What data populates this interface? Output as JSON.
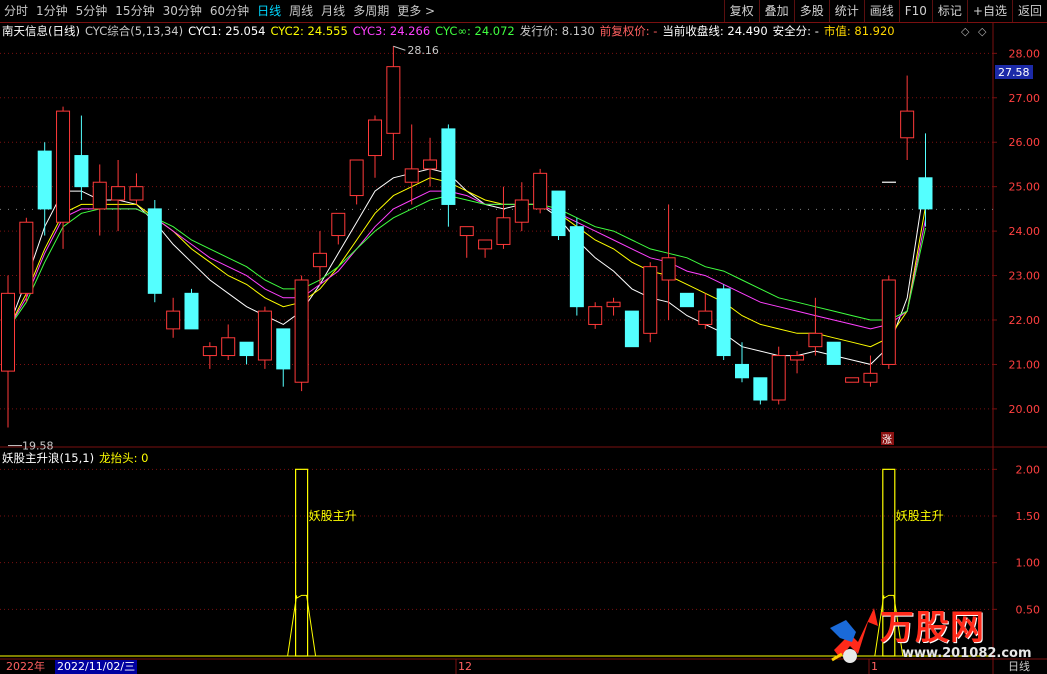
{
  "toolbar": {
    "periods": [
      "分时",
      "1分钟",
      "5分钟",
      "15分钟",
      "30分钟",
      "60分钟",
      "日线",
      "周线",
      "月线",
      "多周期",
      "更多 >"
    ],
    "active_period": "日线",
    "right_buttons": [
      "复权",
      "叠加",
      "多股",
      "统计",
      "画线",
      "F10",
      "标记",
      "+自选",
      "返回"
    ]
  },
  "main_legend": {
    "stock": "南天信息(日线)",
    "indicator": "CYC综合(5,13,34)",
    "cyc1": "CYC1: 25.054",
    "cyc2": "CYC2: 24.555",
    "cyc3": "CYC3: 24.266",
    "cycinf": "CYC∞: 24.072",
    "issue_price": "发行价: 8.130",
    "pre_adjust": "前复权价: -",
    "current_close": "当前收盘线: 24.490",
    "safety": "安全分: -",
    "market_cap": "市值: 81.920"
  },
  "sub_legend": {
    "indicator": "妖股主升浪(15,1)",
    "dragon": "龙抬头: 0"
  },
  "price_axis": [
    "28.00",
    "27.00",
    "26.00",
    "25.00",
    "24.00",
    "23.00",
    "22.00",
    "21.00",
    "20.00"
  ],
  "current_price_tag": "27.58",
  "sub_axis": [
    "2.00",
    "1.50",
    "1.00",
    "0.50"
  ],
  "annotations": {
    "high": "28.16",
    "low": "19.58",
    "zhang": "涨",
    "signal_label": "妖股主升"
  },
  "bottom": {
    "year": "2022年",
    "date": "2022/11/02/三",
    "dec": "12",
    "jan": "1",
    "period": "日线"
  },
  "watermark": {
    "brand": "万股网",
    "url": "www.201082.com"
  },
  "colors": {
    "up": "#ff3a3a",
    "down": "#54ffff",
    "cyc1": "#ffffff",
    "cyc2": "#ffff00",
    "cyc3": "#ff40ff",
    "cycinf": "#40ff40",
    "grid": "#7a1010"
  },
  "chart_data": {
    "type": "candlestick",
    "title": "南天信息(日线)",
    "ylim": [
      19.3,
      28.3
    ],
    "candles": [
      {
        "o": 20.85,
        "h": 23.0,
        "l": 19.58,
        "c": 22.6
      },
      {
        "o": 22.6,
        "h": 24.3,
        "l": 22.4,
        "c": 24.2
      },
      {
        "o": 25.8,
        "h": 26.0,
        "l": 23.9,
        "c": 24.5
      },
      {
        "o": 24.2,
        "h": 26.8,
        "l": 23.6,
        "c": 26.7
      },
      {
        "o": 25.7,
        "h": 26.6,
        "l": 24.7,
        "c": 25.0
      },
      {
        "o": 24.5,
        "h": 25.5,
        "l": 23.9,
        "c": 25.1
      },
      {
        "o": 24.7,
        "h": 25.6,
        "l": 24.0,
        "c": 25.0
      },
      {
        "o": 24.7,
        "h": 25.3,
        "l": 24.6,
        "c": 25.0
      },
      {
        "o": 24.5,
        "h": 24.7,
        "l": 22.4,
        "c": 22.6
      },
      {
        "o": 21.8,
        "h": 22.5,
        "l": 21.6,
        "c": 22.2
      },
      {
        "o": 22.6,
        "h": 22.7,
        "l": 21.8,
        "c": 21.8
      },
      {
        "o": 21.2,
        "h": 21.5,
        "l": 20.9,
        "c": 21.4
      },
      {
        "o": 21.2,
        "h": 21.9,
        "l": 21.1,
        "c": 21.6
      },
      {
        "o": 21.5,
        "h": 21.5,
        "l": 21.0,
        "c": 21.2
      },
      {
        "o": 21.1,
        "h": 22.3,
        "l": 20.9,
        "c": 22.2
      },
      {
        "o": 21.8,
        "h": 21.8,
        "l": 20.5,
        "c": 20.9
      },
      {
        "o": 20.6,
        "h": 23.0,
        "l": 20.4,
        "c": 22.9
      },
      {
        "o": 23.2,
        "h": 24.0,
        "l": 22.8,
        "c": 23.5
      },
      {
        "o": 23.9,
        "h": 24.4,
        "l": 23.7,
        "c": 24.4
      },
      {
        "o": 24.8,
        "h": 25.6,
        "l": 24.6,
        "c": 25.6
      },
      {
        "o": 25.7,
        "h": 26.6,
        "l": 25.2,
        "c": 26.5
      },
      {
        "o": 26.2,
        "h": 28.16,
        "l": 25.6,
        "c": 27.7
      },
      {
        "o": 25.1,
        "h": 26.4,
        "l": 24.6,
        "c": 25.4
      },
      {
        "o": 25.4,
        "h": 26.1,
        "l": 25.0,
        "c": 25.6
      },
      {
        "o": 26.3,
        "h": 26.4,
        "l": 24.1,
        "c": 24.6
      },
      {
        "o": 23.9,
        "h": 24.1,
        "l": 23.4,
        "c": 24.1
      },
      {
        "o": 23.6,
        "h": 23.8,
        "l": 23.4,
        "c": 23.8
      },
      {
        "o": 23.7,
        "h": 25.0,
        "l": 23.6,
        "c": 24.3
      },
      {
        "o": 24.2,
        "h": 25.1,
        "l": 24.0,
        "c": 24.7
      },
      {
        "o": 24.5,
        "h": 25.4,
        "l": 24.4,
        "c": 25.3
      },
      {
        "o": 24.9,
        "h": 24.9,
        "l": 23.8,
        "c": 23.9
      },
      {
        "o": 24.1,
        "h": 24.3,
        "l": 22.1,
        "c": 22.3
      },
      {
        "o": 21.9,
        "h": 22.4,
        "l": 21.8,
        "c": 22.3
      },
      {
        "o": 22.3,
        "h": 22.5,
        "l": 22.1,
        "c": 22.4
      },
      {
        "o": 22.2,
        "h": 22.2,
        "l": 21.4,
        "c": 21.4
      },
      {
        "o": 21.7,
        "h": 23.3,
        "l": 21.5,
        "c": 23.2
      },
      {
        "o": 22.9,
        "h": 24.6,
        "l": 22.0,
        "c": 23.4
      },
      {
        "o": 22.6,
        "h": 22.6,
        "l": 22.3,
        "c": 22.3
      },
      {
        "o": 21.9,
        "h": 22.6,
        "l": 21.8,
        "c": 22.2
      },
      {
        "o": 22.7,
        "h": 22.8,
        "l": 21.1,
        "c": 21.2
      },
      {
        "o": 21.0,
        "h": 21.5,
        "l": 20.6,
        "c": 20.7
      },
      {
        "o": 20.7,
        "h": 20.7,
        "l": 20.1,
        "c": 20.2
      },
      {
        "o": 20.2,
        "h": 21.4,
        "l": 20.1,
        "c": 21.2
      },
      {
        "o": 21.1,
        "h": 21.3,
        "l": 20.8,
        "c": 21.2
      },
      {
        "o": 21.4,
        "h": 22.5,
        "l": 21.2,
        "c": 21.7
      },
      {
        "o": 21.5,
        "h": 21.5,
        "l": 21.0,
        "c": 21.0
      },
      {
        "o": 20.6,
        "h": 20.7,
        "l": 20.6,
        "c": 20.7
      },
      {
        "o": 20.6,
        "h": 21.2,
        "l": 20.5,
        "c": 20.8
      },
      {
        "o": 21.0,
        "h": 23.0,
        "l": 20.9,
        "c": 22.9
      },
      {
        "o": 26.1,
        "h": 27.5,
        "l": 25.6,
        "c": 26.7
      },
      {
        "o": 25.2,
        "h": 26.2,
        "l": 24.1,
        "c": 24.5
      }
    ],
    "cyc_series": [
      {
        "name": "CYC1",
        "values": [
          21.8,
          22.9,
          24.1,
          24.9,
          24.9,
          24.7,
          24.7,
          24.6,
          24.2,
          23.7,
          23.3,
          22.9,
          22.6,
          22.3,
          22.1,
          21.9,
          22.2,
          22.8,
          23.5,
          24.2,
          24.9,
          25.2,
          25.3,
          25.4,
          25.3,
          24.9,
          24.6,
          24.5,
          24.6,
          24.6,
          24.3,
          23.8,
          23.4,
          23.1,
          22.7,
          22.5,
          22.4,
          22.1,
          21.9,
          21.7,
          21.4,
          21.3,
          21.2,
          21.2,
          21.3,
          21.2,
          21.1,
          21.0,
          21.4,
          22.5,
          25.2
        ]
      },
      {
        "name": "CYC2",
        "values": [
          21.8,
          22.6,
          23.6,
          24.4,
          24.6,
          24.6,
          24.6,
          24.6,
          24.3,
          24.0,
          23.6,
          23.3,
          23.0,
          22.8,
          22.5,
          22.3,
          22.4,
          22.7,
          23.2,
          23.8,
          24.4,
          24.8,
          25.0,
          25.2,
          25.1,
          24.9,
          24.7,
          24.6,
          24.6,
          24.6,
          24.4,
          24.1,
          23.8,
          23.6,
          23.3,
          23.1,
          23.0,
          22.8,
          22.6,
          22.4,
          22.1,
          21.9,
          21.8,
          21.7,
          21.7,
          21.6,
          21.5,
          21.4,
          21.6,
          22.2,
          24.55
        ]
      },
      {
        "name": "CYC3",
        "values": [
          21.8,
          22.5,
          23.5,
          24.3,
          24.5,
          24.5,
          24.5,
          24.5,
          24.3,
          24.0,
          23.7,
          23.4,
          23.2,
          23.0,
          22.7,
          22.5,
          22.5,
          22.8,
          23.1,
          23.6,
          24.1,
          24.5,
          24.7,
          24.9,
          24.9,
          24.8,
          24.6,
          24.6,
          24.6,
          24.6,
          24.4,
          24.2,
          24.0,
          23.8,
          23.6,
          23.4,
          23.3,
          23.1,
          23.0,
          22.8,
          22.6,
          22.4,
          22.3,
          22.2,
          22.1,
          22.0,
          21.9,
          21.8,
          21.9,
          22.2,
          24.27
        ]
      },
      {
        "name": "CYC∞",
        "values": [
          21.8,
          22.4,
          23.3,
          24.1,
          24.4,
          24.5,
          24.5,
          24.5,
          24.3,
          24.1,
          23.8,
          23.6,
          23.4,
          23.2,
          22.9,
          22.7,
          22.7,
          22.9,
          23.2,
          23.6,
          24.0,
          24.3,
          24.5,
          24.7,
          24.8,
          24.7,
          24.6,
          24.6,
          24.6,
          24.6,
          24.5,
          24.3,
          24.1,
          24.0,
          23.8,
          23.6,
          23.5,
          23.4,
          23.2,
          23.1,
          22.9,
          22.7,
          22.5,
          22.4,
          22.3,
          22.2,
          22.1,
          22.0,
          22.0,
          22.2,
          24.07
        ]
      }
    ],
    "signal": {
      "name": "妖股主升浪",
      "ylim": [
        0,
        2.1
      ],
      "pulses": [
        {
          "index": 16,
          "value": 2.0
        },
        {
          "index": 48,
          "value": 2.0
        }
      ]
    }
  }
}
